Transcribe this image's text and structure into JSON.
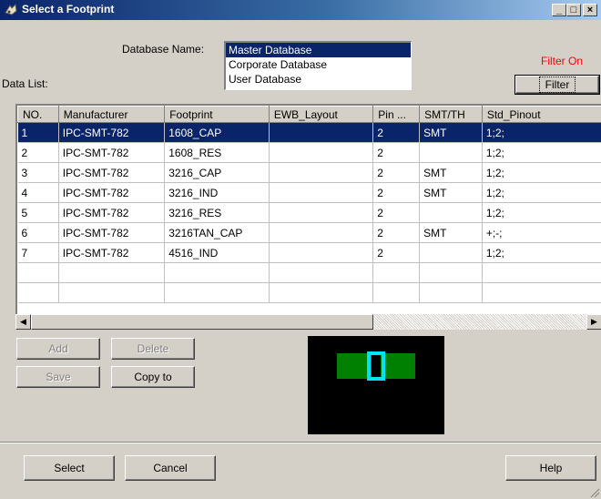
{
  "window": {
    "title": "Select a Footprint",
    "controls": {
      "minimize": "_",
      "maximize": "□",
      "close": "×"
    }
  },
  "database": {
    "label": "Database Name:",
    "options": [
      "Master Database",
      "Corporate Database",
      "User Database"
    ],
    "selected": "Master Database"
  },
  "data_list_label": "Data List:",
  "filter": {
    "status": "Filter On",
    "button_label": "Filter"
  },
  "table": {
    "columns": [
      "NO.",
      "Manufacturer",
      "Footprint",
      "EWB_Layout",
      "Pin ...",
      "SMT/TH",
      "Std_Pinout"
    ],
    "rows": [
      [
        "1",
        "IPC-SMT-782",
        "1608_CAP",
        "",
        "2",
        "SMT",
        "1;2;"
      ],
      [
        "2",
        "IPC-SMT-782",
        "1608_RES",
        "",
        "2",
        "",
        "1;2;"
      ],
      [
        "3",
        "IPC-SMT-782",
        "3216_CAP",
        "",
        "2",
        "SMT",
        "1;2;"
      ],
      [
        "4",
        "IPC-SMT-782",
        "3216_IND",
        "",
        "2",
        "SMT",
        "1;2;"
      ],
      [
        "5",
        "IPC-SMT-782",
        "3216_RES",
        "",
        "2",
        "",
        "1;2;"
      ],
      [
        "6",
        "IPC-SMT-782",
        "3216TAN_CAP",
        "",
        "2",
        "SMT",
        "+;-;"
      ],
      [
        "7",
        "IPC-SMT-782",
        "4516_IND",
        "",
        "2",
        "",
        "1;2;"
      ],
      [
        "",
        "",
        "",
        "",
        "",
        "",
        ""
      ],
      [
        "",
        "",
        "",
        "",
        "",
        "",
        ""
      ]
    ],
    "selected_row": 0
  },
  "actions": {
    "add": "Add",
    "delete": "Delete",
    "save": "Save",
    "copy_to": "Copy to"
  },
  "footer": {
    "select": "Select",
    "cancel": "Cancel",
    "help": "Help"
  },
  "colors": {
    "selection": "#0a246a",
    "pad": "#008000",
    "pin_outline": "#00e0ff",
    "filter_status": "#ff0000"
  }
}
